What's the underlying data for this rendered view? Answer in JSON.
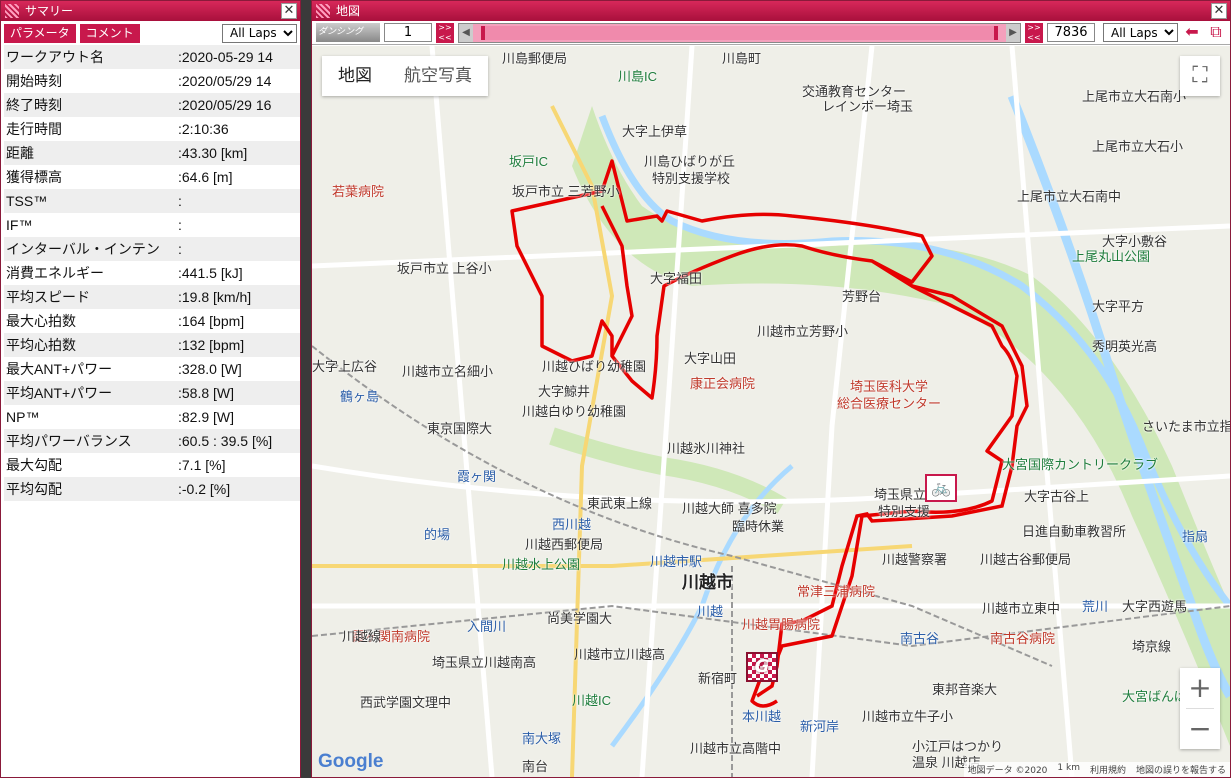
{
  "summary": {
    "title": "サマリー",
    "close": "✕",
    "tabs": [
      "パラメータ",
      "コメント"
    ],
    "lap_select": "All Laps",
    "rows": [
      {
        "k": "ワークアウト名",
        "v": ":2020-05-29 14"
      },
      {
        "k": "開始時刻",
        "v": ":2020/05/29 14"
      },
      {
        "k": "終了時刻",
        "v": ":2020/05/29 16"
      },
      {
        "k": "走行時間",
        "v": ":2:10:36"
      },
      {
        "k": "距離",
        "v": ":43.30 [km]"
      },
      {
        "k": "獲得標高",
        "v": ":64.6 [m]"
      },
      {
        "k": "TSS™",
        "v": ":"
      },
      {
        "k": "IF™",
        "v": ":"
      },
      {
        "k": "インターバル・インテン",
        "v": ":"
      },
      {
        "k": "消費エネルギー",
        "v": ":441.5 [kJ]"
      },
      {
        "k": "平均スピード",
        "v": ":19.8 [km/h]"
      },
      {
        "k": "最大心拍数",
        "v": ":164 [bpm]"
      },
      {
        "k": "平均心拍数",
        "v": ":132 [bpm]"
      },
      {
        "k": "最大ANT+パワー",
        "v": ":328.0 [W]"
      },
      {
        "k": "平均ANT+パワー",
        "v": ":58.8 [W]"
      },
      {
        "k": "NP™",
        "v": ":82.9 [W]"
      },
      {
        "k": "平均パワーバランス",
        "v": ":60.5 : 39.5 [%]"
      },
      {
        "k": "最大勾配",
        "v": ":7.1 [%]"
      },
      {
        "k": "平均勾配",
        "v": ":-0.2 [%]"
      }
    ]
  },
  "map": {
    "title": "地図",
    "close": "✕",
    "mode_label": "ダンシング",
    "start_index": "1",
    "end_index": "7836",
    "lap_select": "All Laps",
    "type_map": "地図",
    "type_aerial": "航空写真",
    "zoom_in": "+",
    "zoom_out": "−",
    "fullscreen": "⛶",
    "goal_marker": "G",
    "bike_marker": "🚲",
    "google": "Google",
    "footer": [
      "地図データ ©2020",
      "1 km",
      "利用規約",
      "地図の誤りを報告する"
    ],
    "labels": [
      {
        "t": "川島郵便局",
        "c": ""
      },
      {
        "t": "川島町",
        "c": ""
      },
      {
        "t": "川島IC",
        "c": "green"
      },
      {
        "t": "交通教育センター",
        "c": ""
      },
      {
        "t": "レインボー埼玉",
        "c": ""
      },
      {
        "t": "上尾市立大石南小",
        "c": ""
      },
      {
        "t": "上尾市立大石小",
        "c": ""
      },
      {
        "t": "大字上伊草",
        "c": ""
      },
      {
        "t": "川島ひばりが丘",
        "c": ""
      },
      {
        "t": "特別支援学校",
        "c": ""
      },
      {
        "t": "坂戸IC",
        "c": "green"
      },
      {
        "t": "坂戸市立 三芳野小",
        "c": ""
      },
      {
        "t": "若葉病院",
        "c": "red"
      },
      {
        "t": "上尾市立大石南中",
        "c": ""
      },
      {
        "t": "上尾丸山公園",
        "c": "green"
      },
      {
        "t": "大字小敷谷",
        "c": ""
      },
      {
        "t": "坂戸市立 上谷小",
        "c": ""
      },
      {
        "t": "大字福田",
        "c": ""
      },
      {
        "t": "芳野台",
        "c": ""
      },
      {
        "t": "大字平方",
        "c": ""
      },
      {
        "t": "川越市立芳野小",
        "c": ""
      },
      {
        "t": "秀明英光高",
        "c": ""
      },
      {
        "t": "大字上広谷",
        "c": ""
      },
      {
        "t": "川越市立名細小",
        "c": ""
      },
      {
        "t": "川越ひばり幼稚園",
        "c": ""
      },
      {
        "t": "大字山田",
        "c": ""
      },
      {
        "t": "康正会病院",
        "c": "red"
      },
      {
        "t": "鶴ヶ島",
        "c": "blue"
      },
      {
        "t": "大字鯨井",
        "c": ""
      },
      {
        "t": "埼玉医科大学",
        "c": "red"
      },
      {
        "t": "総合医療センター",
        "c": "red"
      },
      {
        "t": "川越白ゆり幼稚園",
        "c": ""
      },
      {
        "t": "さいたま市立指",
        "c": ""
      },
      {
        "t": "東京国際大",
        "c": ""
      },
      {
        "t": "川越氷川神社",
        "c": ""
      },
      {
        "t": "大宮国際カントリークラブ",
        "c": "green"
      },
      {
        "t": "霞ヶ関",
        "c": "blue"
      },
      {
        "t": "東武東上線",
        "c": ""
      },
      {
        "t": "川越大師 喜多院",
        "c": ""
      },
      {
        "t": "埼玉県立",
        "c": ""
      },
      {
        "t": "特別支援",
        "c": ""
      },
      {
        "t": "大字古谷上",
        "c": ""
      },
      {
        "t": "日進自動車教習所",
        "c": ""
      },
      {
        "t": "的場",
        "c": "blue"
      },
      {
        "t": "西川越",
        "c": "blue"
      },
      {
        "t": "臨時休業",
        "c": ""
      },
      {
        "t": "指扇",
        "c": "blue"
      },
      {
        "t": "川越西郵便局",
        "c": ""
      },
      {
        "t": "川越水上公園",
        "c": "green"
      },
      {
        "t": "川越市駅",
        "c": "blue"
      },
      {
        "t": "川越市",
        "c": "big"
      },
      {
        "t": "川越警察署",
        "c": ""
      },
      {
        "t": "川越古谷郵便局",
        "c": ""
      },
      {
        "t": "常津三浦病院",
        "c": "red"
      },
      {
        "t": "尚美学園大",
        "c": ""
      },
      {
        "t": "川越",
        "c": "blue"
      },
      {
        "t": "川越市立東中",
        "c": ""
      },
      {
        "t": "大字西遊馬",
        "c": ""
      },
      {
        "t": "霞ヶ関南病院",
        "c": "red"
      },
      {
        "t": "川越胃腸病院",
        "c": "red"
      },
      {
        "t": "南古谷",
        "c": "blue"
      },
      {
        "t": "南古谷病院",
        "c": "red"
      },
      {
        "t": "埼玉県立川越南高",
        "c": ""
      },
      {
        "t": "川越市立川越高",
        "c": ""
      },
      {
        "t": "新宿町",
        "c": ""
      },
      {
        "t": "東邦音楽大",
        "c": ""
      },
      {
        "t": "西武学園文理中",
        "c": ""
      },
      {
        "t": "川越IC",
        "c": "green"
      },
      {
        "t": "本川越",
        "c": "blue"
      },
      {
        "t": "新河岸",
        "c": "blue"
      },
      {
        "t": "川越市立牛子小",
        "c": ""
      },
      {
        "t": "大宮ばんぱ",
        "c": "green"
      },
      {
        "t": "南大塚",
        "c": "blue"
      },
      {
        "t": "川越市立高階中",
        "c": ""
      },
      {
        "t": "小江戸はつかり",
        "c": ""
      },
      {
        "t": "温泉 川越店",
        "c": ""
      },
      {
        "t": "南台",
        "c": ""
      },
      {
        "t": "入間川",
        "c": "blue"
      },
      {
        "t": "荒川",
        "c": "blue"
      },
      {
        "t": "埼京線",
        "c": ""
      },
      {
        "t": "川越線",
        "c": ""
      }
    ]
  }
}
